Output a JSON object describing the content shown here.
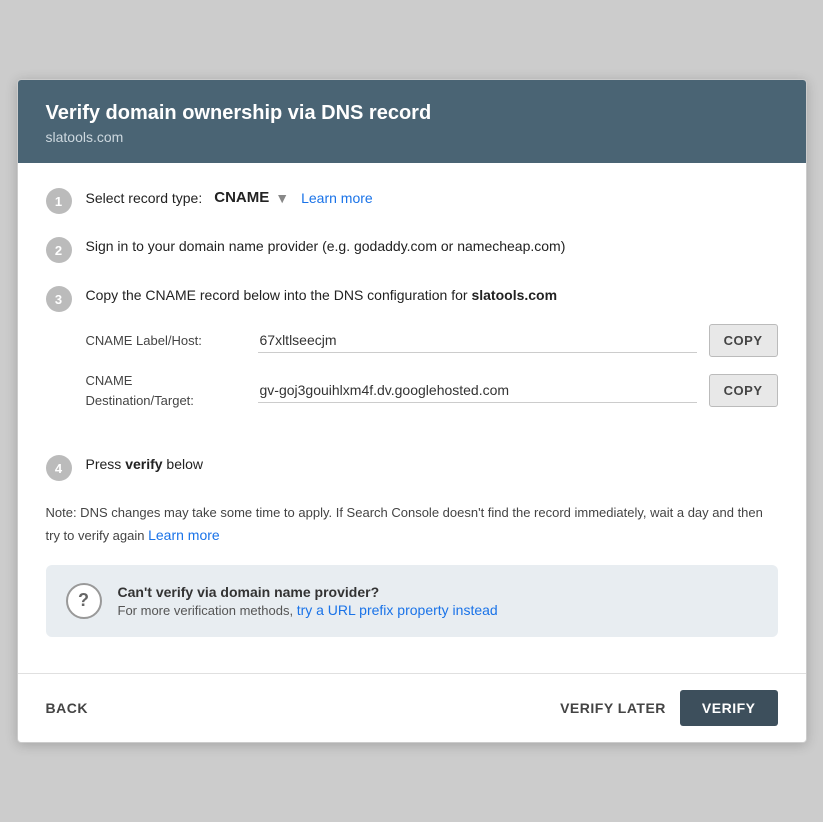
{
  "header": {
    "title": "Verify domain ownership via DNS record",
    "subtitle": "slatools.com"
  },
  "steps": [
    {
      "number": "1",
      "label": "Select record type:",
      "record_type": "CNAME",
      "learn_more": "Learn more"
    },
    {
      "number": "2",
      "text": "Sign in to your domain name provider (e.g. godaddy.com or namecheap.com)"
    },
    {
      "number": "3",
      "text_before": "Copy the CNAME record below into the DNS configuration for ",
      "domain": "slatools.com",
      "fields": [
        {
          "label": "CNAME Label/Host:",
          "value": "67xltlseecjm",
          "copy_label": "COPY"
        },
        {
          "label": "CNAME\nDestination/Target:",
          "value": "gv-goj3gouihlxm4f.dv.googlehosted.com",
          "copy_label": "COPY"
        }
      ]
    },
    {
      "number": "4",
      "text_before": "Press ",
      "bold": "verify",
      "text_after": " below"
    }
  ],
  "note": {
    "text": "Note: DNS changes may take some time to apply. If Search Console doesn't find the record immediately, wait a day and then try to verify again ",
    "learn_more": "Learn more"
  },
  "info_box": {
    "icon": "?",
    "title": "Can't verify via domain name provider?",
    "desc_before": "For more verification methods, ",
    "link_text": "try a URL prefix property instead",
    "desc_after": ""
  },
  "footer": {
    "back_label": "BACK",
    "verify_later_label": "VERIFY LATER",
    "verify_label": "VERIFY"
  }
}
